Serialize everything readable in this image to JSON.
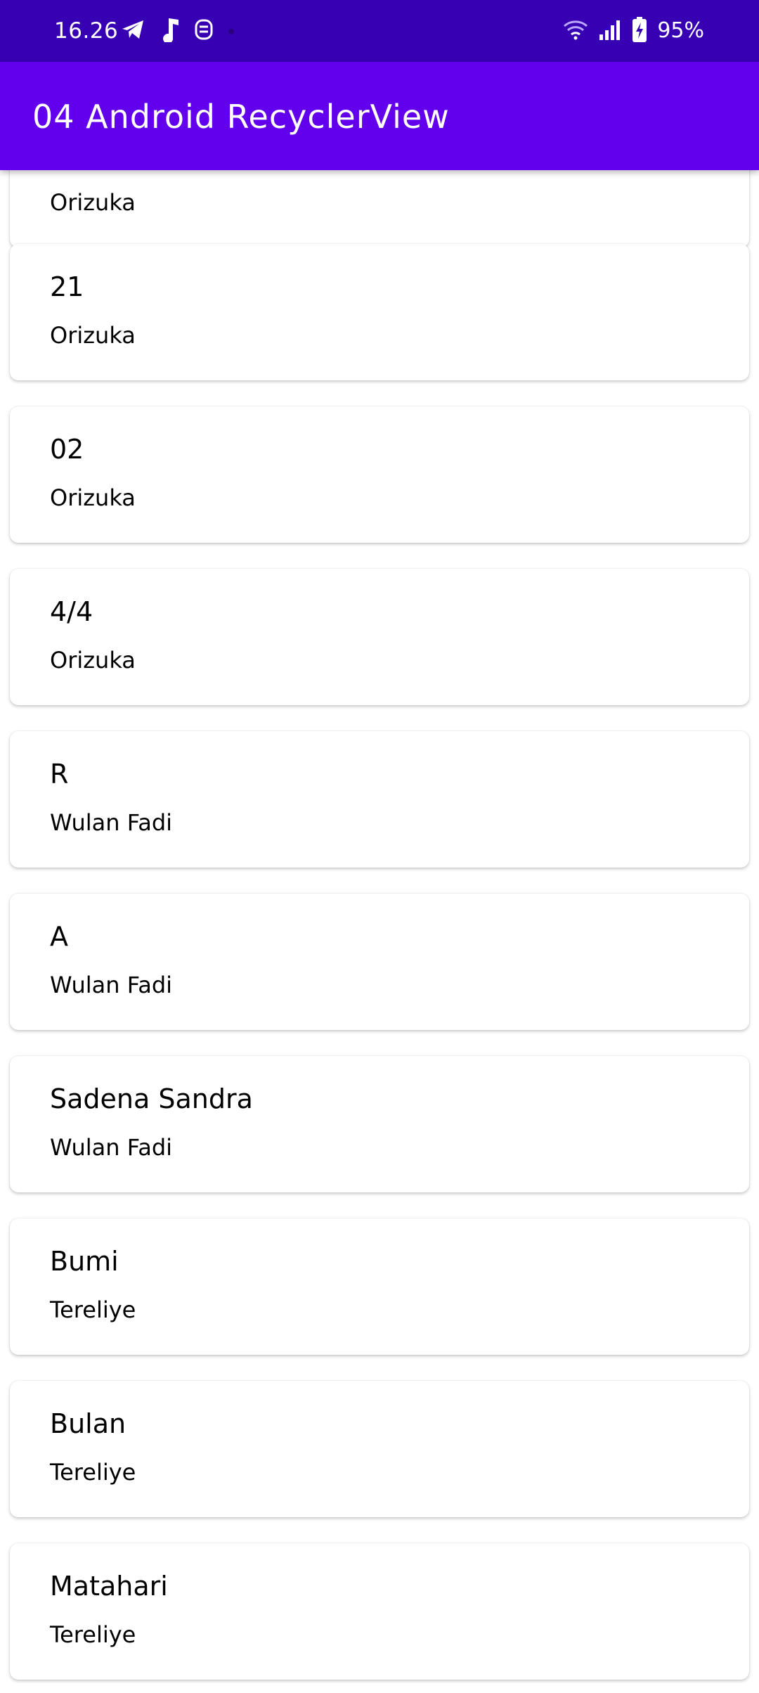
{
  "status_bar": {
    "time": "16.26",
    "battery": "95%",
    "background": "#3700b3"
  },
  "app_bar": {
    "title": "04 Android RecyclerView",
    "background": "#6200ee"
  },
  "books": [
    {
      "title": "",
      "author": "Orizuka"
    },
    {
      "title": "21",
      "author": "Orizuka"
    },
    {
      "title": "02",
      "author": "Orizuka"
    },
    {
      "title": "4/4",
      "author": "Orizuka"
    },
    {
      "title": "R",
      "author": "Wulan Fadi"
    },
    {
      "title": "A",
      "author": "Wulan Fadi"
    },
    {
      "title": "Sadena Sandra",
      "author": "Wulan Fadi"
    },
    {
      "title": "Bumi",
      "author": "Tereliye"
    },
    {
      "title": "Bulan",
      "author": "Tereliye"
    },
    {
      "title": "Matahari",
      "author": "Tereliye"
    }
  ]
}
